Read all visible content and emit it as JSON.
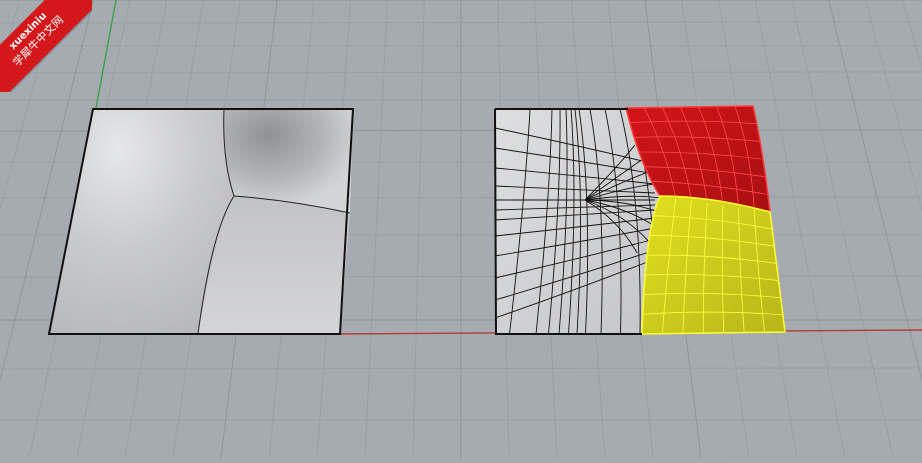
{
  "watermark": {
    "line1": "xuexiniu",
    "line2": "学犀牛中文网"
  },
  "colors": {
    "background": "#a6abb1",
    "grid_line": "#9aa0a6",
    "grid_major": "#8f959b",
    "x_axis": "#b53a30",
    "y_axis": "#3aa34a",
    "surface_edge": "#111111",
    "selected_red": "#e8181c",
    "selected_yellow": "#f2f22a",
    "brand_red": "#d4171b"
  },
  "scene": {
    "objects": [
      {
        "name": "shaded-surface-patch",
        "selected": false
      },
      {
        "name": "wireframe-surface-patch",
        "selected": false
      },
      {
        "name": "red-selected-subpatch",
        "selected": true
      },
      {
        "name": "yellow-selected-subpatch",
        "selected": true
      }
    ]
  }
}
